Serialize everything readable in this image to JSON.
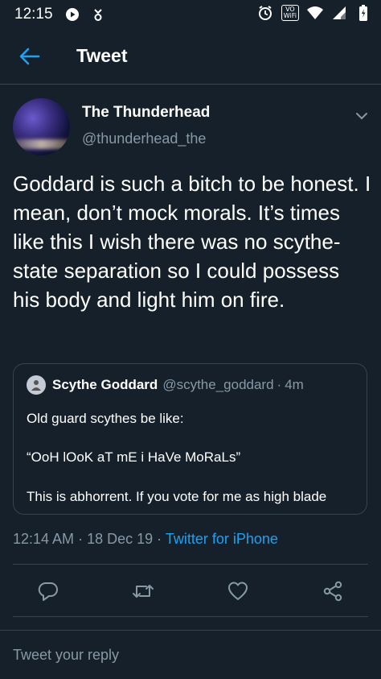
{
  "status_bar": {
    "time": "12:15",
    "icons": [
      "play-icon",
      "download-icon",
      "alarm-icon",
      "vowifi-icon",
      "wifi-icon",
      "signal-icon",
      "battery-icon"
    ],
    "vowifi_label_top": "VO",
    "vowifi_label_bottom": "WiFi"
  },
  "app_bar": {
    "title": "Tweet",
    "back_icon": "back-arrow-icon"
  },
  "tweet": {
    "author_name": "The Thunderhead",
    "author_handle": "@thunderhead_the",
    "text": "Goddard is such a bitch to be honest. I mean, don’t mock morals. It’s times like this I wish there was no scythe-state separation so I could possess his body and light him on fire.",
    "timestamp": "12:14 AM",
    "date": "18 Dec 19",
    "source": "Twitter for iPhone",
    "separator": "·"
  },
  "quoted_tweet": {
    "author_name": "Scythe Goddard",
    "author_handle": "@scythe_goddard",
    "time": "4m",
    "separator": "·",
    "line1": "Old guard scythes be like:",
    "line2": "“OoH lOoK aT mE i HaVe MoRaLs”",
    "line3": "This is abhorrent. If you vote for me as high blade"
  },
  "actions": {
    "icons": [
      "reply-icon",
      "retweet-icon",
      "like-icon",
      "share-icon"
    ]
  },
  "reply": {
    "placeholder": "Tweet your reply"
  },
  "colors": {
    "background": "#15202b",
    "divider": "#38444d",
    "secondary_text": "#8899a6",
    "accent": "#1da1f2"
  }
}
